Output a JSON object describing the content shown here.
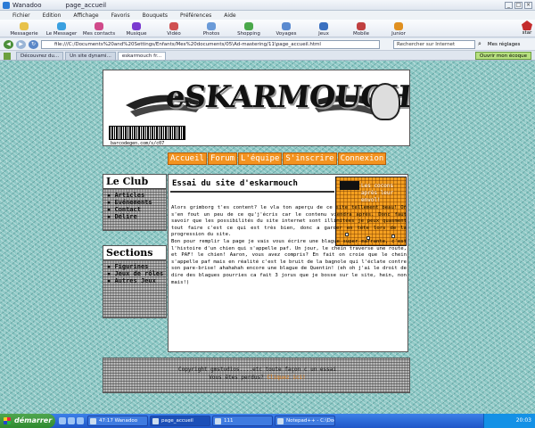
{
  "window": {
    "app": "Wanadoo",
    "title": "page_accueil",
    "controls": [
      "_",
      "□",
      "×"
    ]
  },
  "menubar": [
    "Fichier",
    "Edition",
    "Affichage",
    "Favoris",
    "Bouquets",
    "Préférences",
    "Aide"
  ],
  "portal": {
    "items": [
      {
        "label": "Messagerie",
        "icon": "mail-icon",
        "color": "#e8c24a"
      },
      {
        "label": "Le Messager",
        "icon": "messenger-icon",
        "color": "#3aa0e0"
      },
      {
        "label": "Mes contacts",
        "icon": "contacts-icon",
        "color": "#d04a8a"
      },
      {
        "label": "Musique",
        "icon": "music-icon",
        "color": "#7a3ad0"
      },
      {
        "label": "Vidéo",
        "icon": "video-icon",
        "color": "#d05050"
      },
      {
        "label": "Photos",
        "icon": "photo-icon",
        "color": "#6a9ad8"
      },
      {
        "label": "Shopping",
        "icon": "shopping-icon",
        "color": "#4aa84a"
      },
      {
        "label": "Voyages",
        "icon": "plane-icon",
        "color": "#5a8ad0"
      },
      {
        "label": "Jeux",
        "icon": "games-icon",
        "color": "#3a70c0"
      },
      {
        "label": "Mobile",
        "icon": "mobile-icon",
        "color": "#c04040"
      },
      {
        "label": "Junior",
        "icon": "junior-icon",
        "color": "#e09020"
      }
    ],
    "right_label": "star"
  },
  "nav": {
    "address": "file:///C:/Documents%20and%20Settings/Enfants/Mes%20documents/05\\Ad-mastering/11\\page_accueil.html",
    "search_placeholder": "Rechercher sur Internet",
    "settings": "Mes réglages"
  },
  "tabs": [
    "Découvrez du...",
    "Un site dynami...",
    "eskarmouch fr..."
  ],
  "tabs_right": "Ouvrir mon écoque",
  "site": {
    "logo": "eSKARMOUCH",
    "barcode_text": "barcodegen.com/s/c07",
    "nav_links": [
      "Accueil",
      "Forum",
      "L'équipe",
      "S'inscrire",
      "Connexion"
    ],
    "club": {
      "title": "Le Club",
      "items": [
        "Articles",
        "Evénements",
        "Contact",
        "Délire"
      ]
    },
    "sections": {
      "title": "Sections",
      "items": [
        "Figurines",
        "Jeux de rôles",
        "Autres Jeux"
      ]
    },
    "main": {
      "title": "Essai du site d'eskarmouch",
      "body": "Alors grimborg t'es content? le vla ton aperçu de ce site tellement beau! On s'en fout un peu de ce qu'j'écris car le contenu viendra après. Donc faut savoir que les possibilités du site internet sont illimitées je peux quasment tout faire c'est ce qui est très bien, donc a garder en tête lors de la progression du site.\nBon pour remplir la page je vais vous écrire une blague super marrante, c'est l'histoire d'un chien qui s'appelle paf. Un jour, le chein traverse une route, et PAF! le chien! Aaron, vous avez compris? En fait on croie que le chein s'appelle paf mais en réalité c'est le bruit de la bagnole qui l'éclate contre son pare-brise! ahahahah encore une blague de Quentin! (eh oh j'ai le droit de dire des blagues pourries ca fait 3 jorus que je bosse sur le site, hein, non mais!)",
      "image_caption": "Les cocons après leur envol!"
    },
    "footer": {
      "line1": "Copyright gmstudios....etc toute façon c un essai",
      "line2_prefix": "Vous êtes perdus?",
      "line2_link": "Cliquez ici!"
    }
  },
  "taskbar": {
    "start": "démarrer",
    "items": [
      "47:17 Wanadoo",
      "page_accueil",
      "111",
      "Notepad++ - C:\\Doc..."
    ],
    "clock": "20:03"
  },
  "colors": {
    "nav_orange": "#f39320",
    "page_teal": "#8bc7c4",
    "footer_link": "#e47c10"
  }
}
